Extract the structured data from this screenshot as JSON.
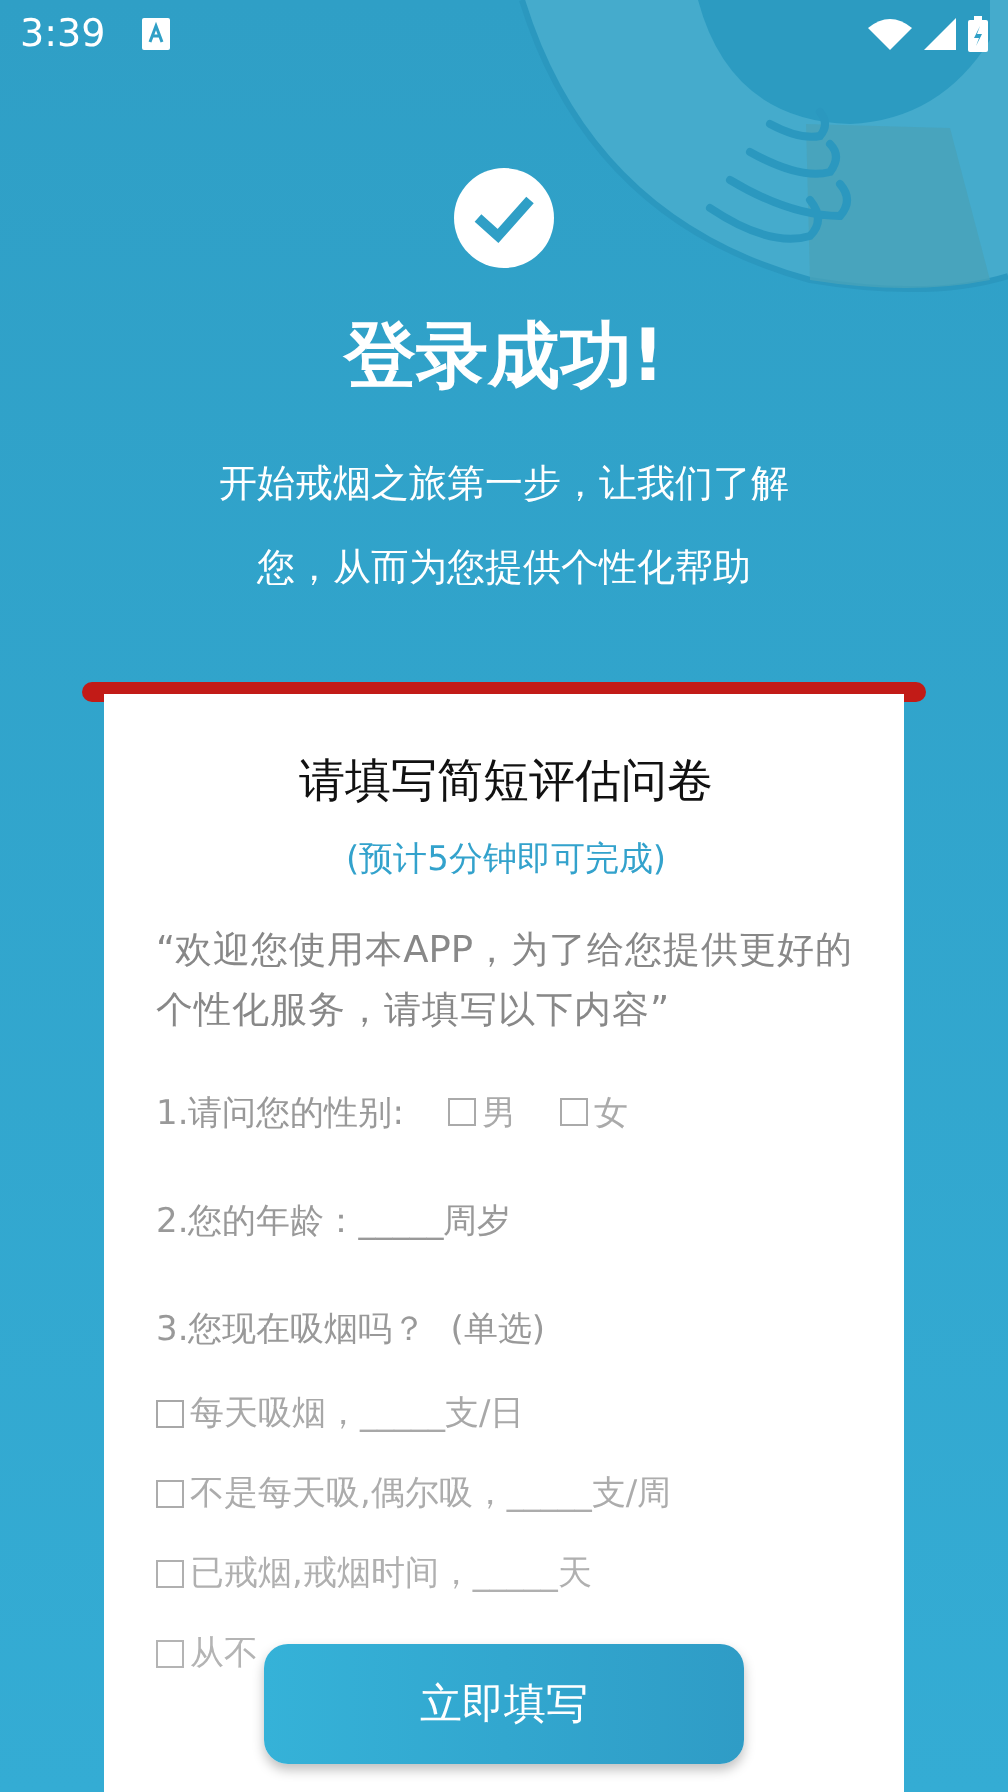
{
  "status_bar": {
    "time": "3:39"
  },
  "header": {
    "title": "登录成功!",
    "subtitle": [
      "开始戒烟之旅第一步，让我们了解",
      "您，从而为您提供个性化帮助"
    ]
  },
  "card": {
    "title": "请填写简短评估问卷",
    "note": "(预计5分钟即可完成)",
    "intro": "“欢迎您使用本APP，为了给您提供更好的个性化服务，请填写以下内容”",
    "questions": [
      {
        "kind": "choice",
        "label": "1.请问您的性别:",
        "options": [
          {
            "label": "男",
            "checked": false
          },
          {
            "label": "女",
            "checked": false
          }
        ]
      },
      {
        "kind": "text",
        "label": "2.您的年龄：_____周岁"
      },
      {
        "kind": "list",
        "label": "3.您现在吸烟吗？",
        "hint": "(单选)",
        "options": [
          {
            "label": "每天吸烟，_____支/日",
            "checked": false
          },
          {
            "label": "不是每天吸,偶尔吸，_____支/周",
            "checked": false
          },
          {
            "label": "已戒烟,戒烟时间，_____天",
            "checked": false
          },
          {
            "label": "从不",
            "checked": false
          }
        ]
      }
    ]
  },
  "button": {
    "label": "立即填写"
  }
}
